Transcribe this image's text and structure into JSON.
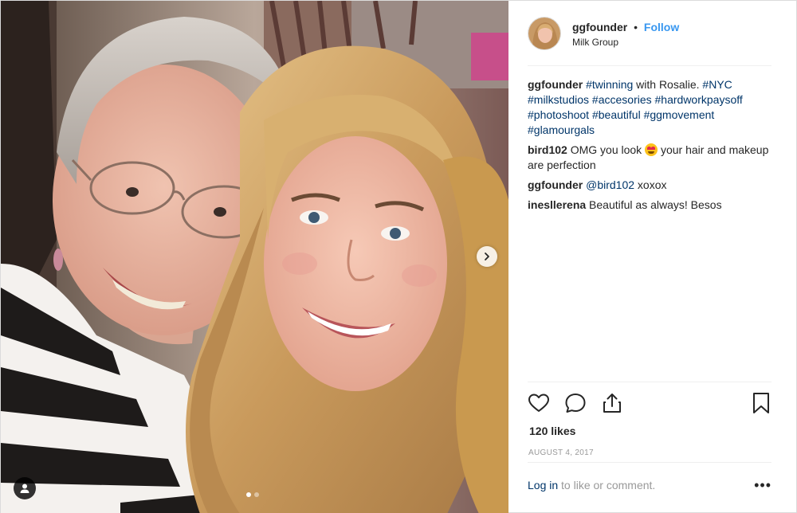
{
  "header": {
    "username": "ggfounder",
    "separator": "•",
    "follow_label": "Follow",
    "location": "Milk Group"
  },
  "comments": [
    {
      "user": "ggfounder",
      "segments": [
        {
          "text": "#twinning",
          "tag": true
        },
        {
          "text": " with Rosalie. ",
          "tag": false
        },
        {
          "text": "#NYC",
          "tag": true
        },
        {
          "text": " ",
          "tag": false
        },
        {
          "text": "#milkstudios",
          "tag": true
        },
        {
          "text": " ",
          "tag": false
        },
        {
          "text": "#accesories",
          "tag": true
        },
        {
          "text": " ",
          "tag": false
        },
        {
          "text": "#hardworkpaysoff",
          "tag": true
        },
        {
          "text": " ",
          "tag": false
        },
        {
          "text": "#photoshoot",
          "tag": true
        },
        {
          "text": " ",
          "tag": false
        },
        {
          "text": "#beautiful",
          "tag": true
        },
        {
          "text": " ",
          "tag": false
        },
        {
          "text": "#ggmovement",
          "tag": true
        },
        {
          "text": " ",
          "tag": false
        },
        {
          "text": "#glamourgals",
          "tag": true
        }
      ]
    },
    {
      "user": "bird102",
      "segments": [
        {
          "text": "OMG you look ",
          "tag": false
        },
        {
          "emoji": "heart-eyes-emoji"
        },
        {
          "text": " your hair and makeup are perfection",
          "tag": false
        }
      ]
    },
    {
      "user": "ggfounder",
      "segments": [
        {
          "text": "@bird102",
          "tag": true
        },
        {
          "text": " xoxox",
          "tag": false
        }
      ]
    },
    {
      "user": "inesllerena",
      "segments": [
        {
          "text": "Beautiful as always! Besos",
          "tag": false
        }
      ]
    }
  ],
  "actions": {
    "icons": [
      "heart-icon",
      "comment-icon",
      "share-icon",
      "bookmark-icon"
    ],
    "likes": "120 likes",
    "date": "AUGUST 4, 2017"
  },
  "footer": {
    "login_link": "Log in",
    "login_rest": " to like or comment.",
    "more_label": "•••"
  },
  "media": {
    "carousel_count": 2,
    "carousel_active": 1,
    "icons": [
      "chevron-right-icon",
      "user-tag-icon"
    ]
  },
  "colors": {
    "link_blue": "#3897f0",
    "hashtag": "#003569",
    "muted": "#999999",
    "text": "#262626"
  }
}
